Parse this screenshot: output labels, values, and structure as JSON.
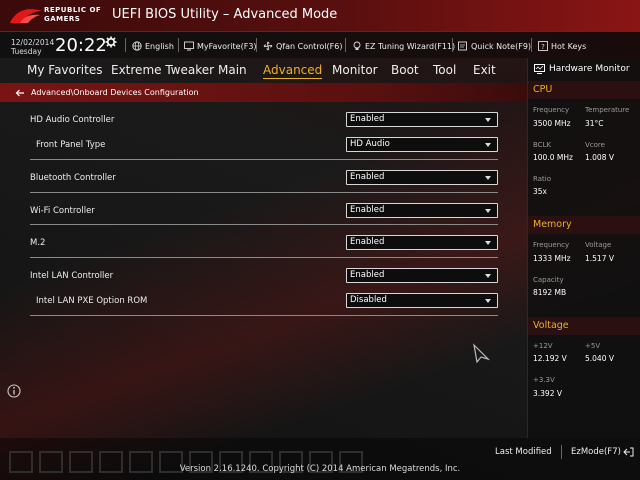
{
  "header": {
    "brand_line1": "REPUBLIC OF",
    "brand_line2": "GAMERS",
    "title": "UEFI BIOS Utility – Advanced Mode"
  },
  "toolbar": {
    "date": "12/02/2014",
    "day": "Tuesday",
    "time": "20:22",
    "language": "English",
    "myfavorite": "MyFavorite(F3)",
    "qfan": "Qfan Control(F6)",
    "ez_tuning": "EZ Tuning Wizard(F11)",
    "quick_note": "Quick Note(F9)",
    "hot_keys": "Hot Keys"
  },
  "menu": {
    "items": [
      {
        "label": "My Favorites"
      },
      {
        "label": "Extreme Tweaker"
      },
      {
        "label": "Main"
      },
      {
        "label": "Advanced"
      },
      {
        "label": "Monitor"
      },
      {
        "label": "Boot"
      },
      {
        "label": "Tool"
      },
      {
        "label": "Exit"
      }
    ],
    "active": "Advanced"
  },
  "breadcrumb": "Advanced\\Onboard Devices Configuration",
  "settings": [
    {
      "label": "HD Audio Controller",
      "value": "Enabled"
    },
    {
      "label": "Front Panel Type",
      "value": "HD Audio"
    },
    {
      "label": "Bluetooth Controller",
      "value": "Enabled"
    },
    {
      "label": "Wi-Fi Controller",
      "value": "Enabled"
    },
    {
      "label": "M.2",
      "value": "Enabled"
    },
    {
      "label": "Intel LAN Controller",
      "value": "Enabled"
    },
    {
      "label": "Intel LAN PXE Option ROM",
      "value": "Disabled"
    }
  ],
  "hw": {
    "title": "Hardware Monitor",
    "cpu": {
      "section": "CPU",
      "frequency_label": "Frequency",
      "frequency": "3500 MHz",
      "temperature_label": "Temperature",
      "temperature": "31°C",
      "bclk_label": "BCLK",
      "bclk": "100.0 MHz",
      "vcore_label": "Vcore",
      "vcore": "1.008 V",
      "ratio_label": "Ratio",
      "ratio": "35x"
    },
    "memory": {
      "section": "Memory",
      "frequency_label": "Frequency",
      "frequency": "1333 MHz",
      "voltage_label": "Voltage",
      "voltage": "1.517 V",
      "capacity_label": "Capacity",
      "capacity": "8192 MB"
    },
    "voltage": {
      "section": "Voltage",
      "v12_label": "+12V",
      "v12": "12.192 V",
      "v5_label": "+5V",
      "v5": "5.040 V",
      "v33_label": "+3.3V",
      "v33": "3.392 V"
    }
  },
  "footer": {
    "last_modified": "Last Modified",
    "ezmode": "EzMode(F7)",
    "version": "Version 2.16.1240. Copyright (C) 2014 American Megatrends, Inc."
  },
  "colors": {
    "accent": "#f0b020",
    "title_red": "#8a1515"
  }
}
